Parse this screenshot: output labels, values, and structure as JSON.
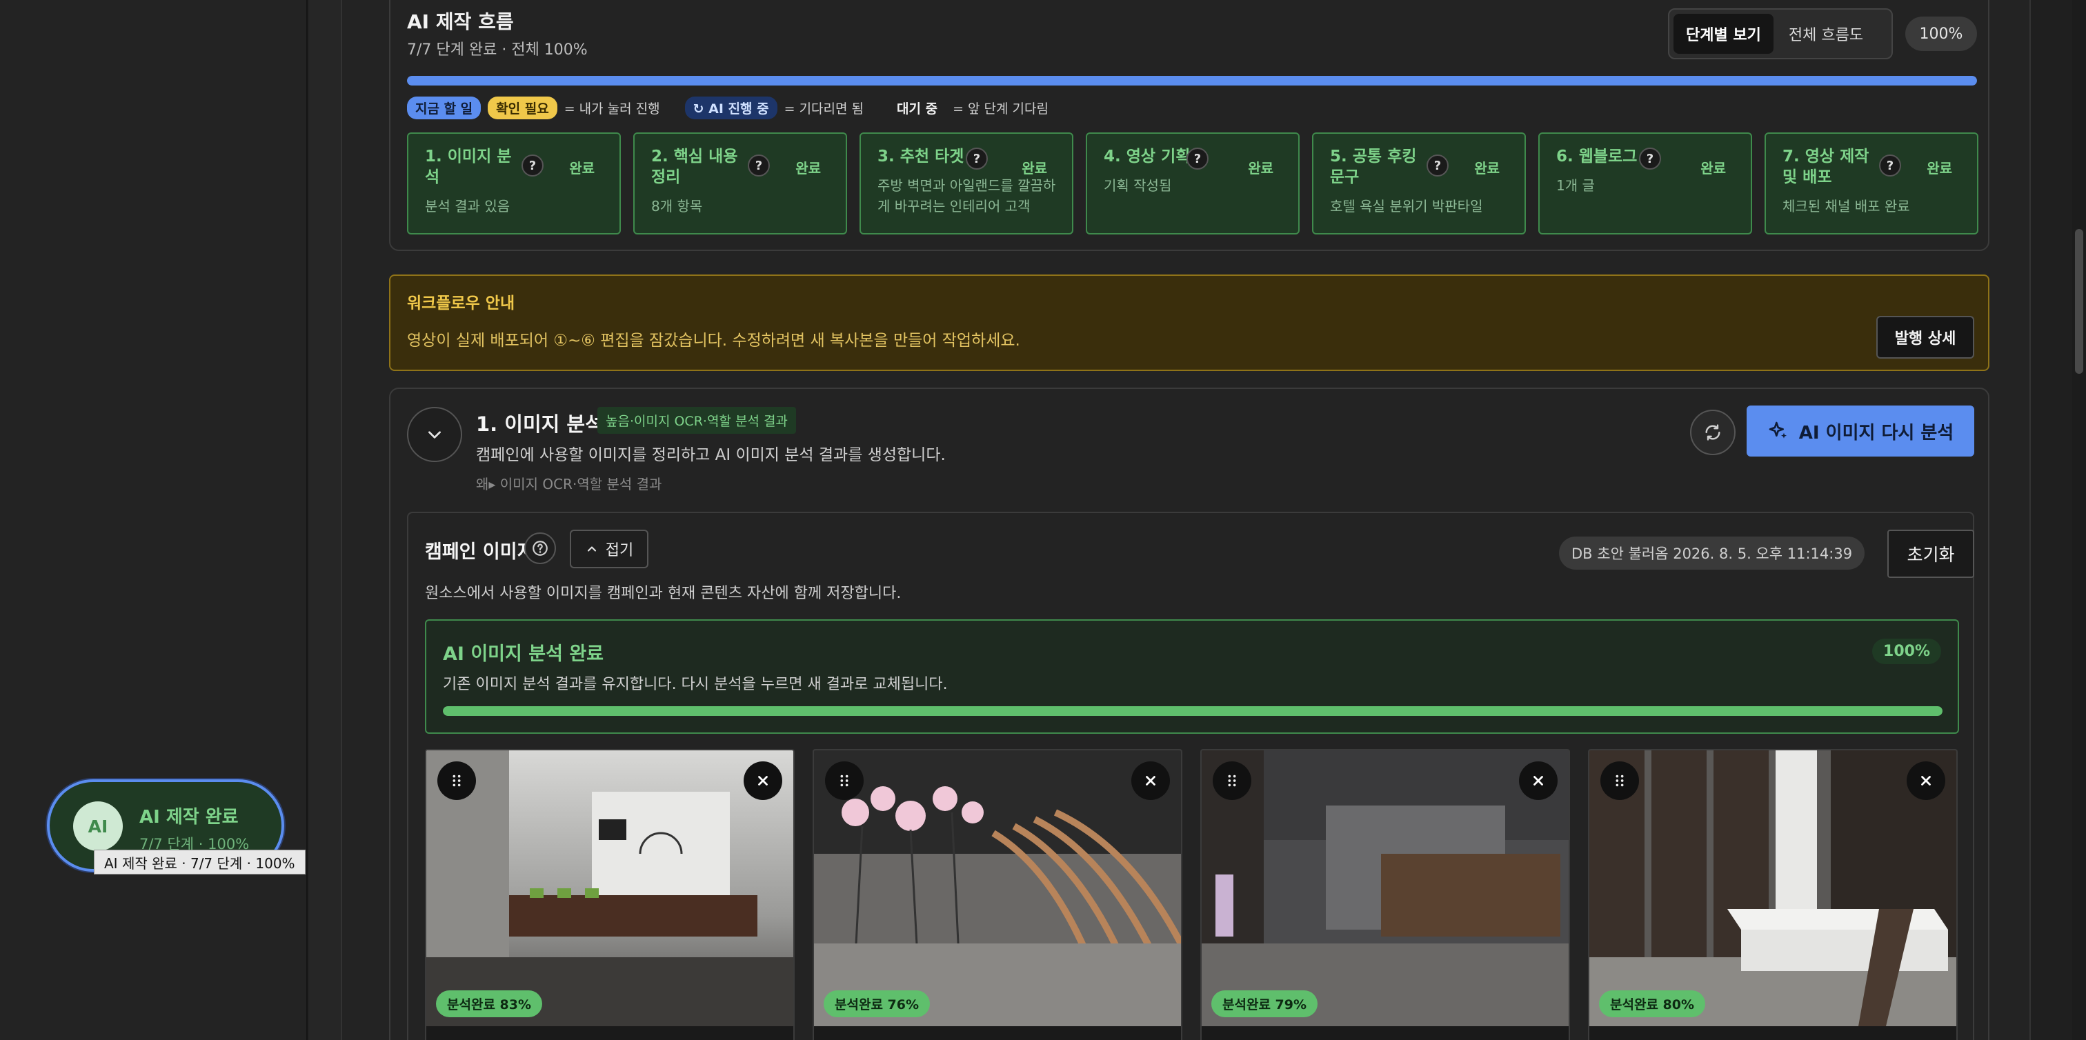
{
  "flow": {
    "title": "AI 제작 흐름",
    "subtitle": "7/7 단계 완료 · 전체 100%",
    "view_step": "단계별 보기",
    "view_all": "전체 흐름도",
    "percent": "100%",
    "progress": 1.0,
    "legend": {
      "now": "지금 할 일",
      "check": "확인 필요",
      "mine": "= 내가 눌러 진행",
      "ai": "↻ AI 진행 중",
      "ai_note": "= 기다리면 됨",
      "wait": "대기 중",
      "wait_note": "= 앞 단계 기다림"
    },
    "steps": [
      {
        "title": "1. 이미지 분석",
        "status": "완료",
        "desc": "분석 결과 있음"
      },
      {
        "title": "2. 핵심 내용 정리",
        "status": "완료",
        "desc": "8개 항목"
      },
      {
        "title": "3. 추천 타겟",
        "status": "완료",
        "desc": "주방 벽면과 아일랜드를 깔끔하게 바꾸려는 인테리어 고객"
      },
      {
        "title": "4. 영상 기획",
        "status": "완료",
        "desc": "기획 작성됨"
      },
      {
        "title": "5. 공통 후킹 문구",
        "status": "완료",
        "desc": "호텔 욕실 분위기 박판타일"
      },
      {
        "title": "6. 웹블로그",
        "status": "완료",
        "desc": "1개 글"
      },
      {
        "title": "7. 영상 제작 및 배포",
        "status": "완료",
        "desc": "체크된 채널 배포 완료"
      }
    ]
  },
  "notice": {
    "title": "워크플로우 안내",
    "text": "영상이 실제 배포되어 ①~⑥ 편집을 잠갔습니다. 수정하려면 새 복사본을 만들어 작업하세요.",
    "button": "발행 상세"
  },
  "section": {
    "title": "1. 이미지 분석",
    "tag": "높음·이미지 OCR·역할 분석 결과",
    "desc": "캠페인에 사용할 이미지를 정리하고 AI 이미지 분석 결과를 생성합니다.",
    "why": "왜▸ 이미지 OCR·역할 분석 결과",
    "reanalyze": "AI 이미지 다시 분석"
  },
  "campaign": {
    "title": "캠페인 이미지",
    "fold": "접기",
    "desc": "원소스에서 사용할 이미지를 캠페인과 현재 콘텐츠 자산에 함께 저장합니다.",
    "db_status": "DB 초안 불러옴 2026. 8. 5. 오후 11:14:39",
    "reset": "초기화",
    "done_title": "AI 이미지 분석 완료",
    "done_desc": "기존 이미지 분석 결과를 유지합니다. 다시 분석을 누르면 새 결과로 교체됩니다.",
    "done_pct": "100%",
    "done_progress": 1.0,
    "images": [
      {
        "badge": "분석완료 83%"
      },
      {
        "badge": "분석완료 76%"
      },
      {
        "badge": "분석완료 79%"
      },
      {
        "badge": "분석완료 80%"
      }
    ]
  },
  "widget": {
    "avatar": "AI",
    "title": "AI 제작 완료",
    "sub": "7/7 단계 · 100%",
    "tooltip": "AI 제작 완료 · 7/7 단계 · 100%"
  },
  "colors": {
    "accent_blue": "#5b8def",
    "success_green": "#7ed38a",
    "warning_yellow": "#f0c84a"
  },
  "icons": {
    "collapse": "chevron-down-icon",
    "refresh": "refresh-icon",
    "sparkle": "sparkle-icon",
    "help": "question-icon",
    "fold": "chevron-up-icon",
    "drag": "drag-handle-icon",
    "remove": "close-icon"
  }
}
